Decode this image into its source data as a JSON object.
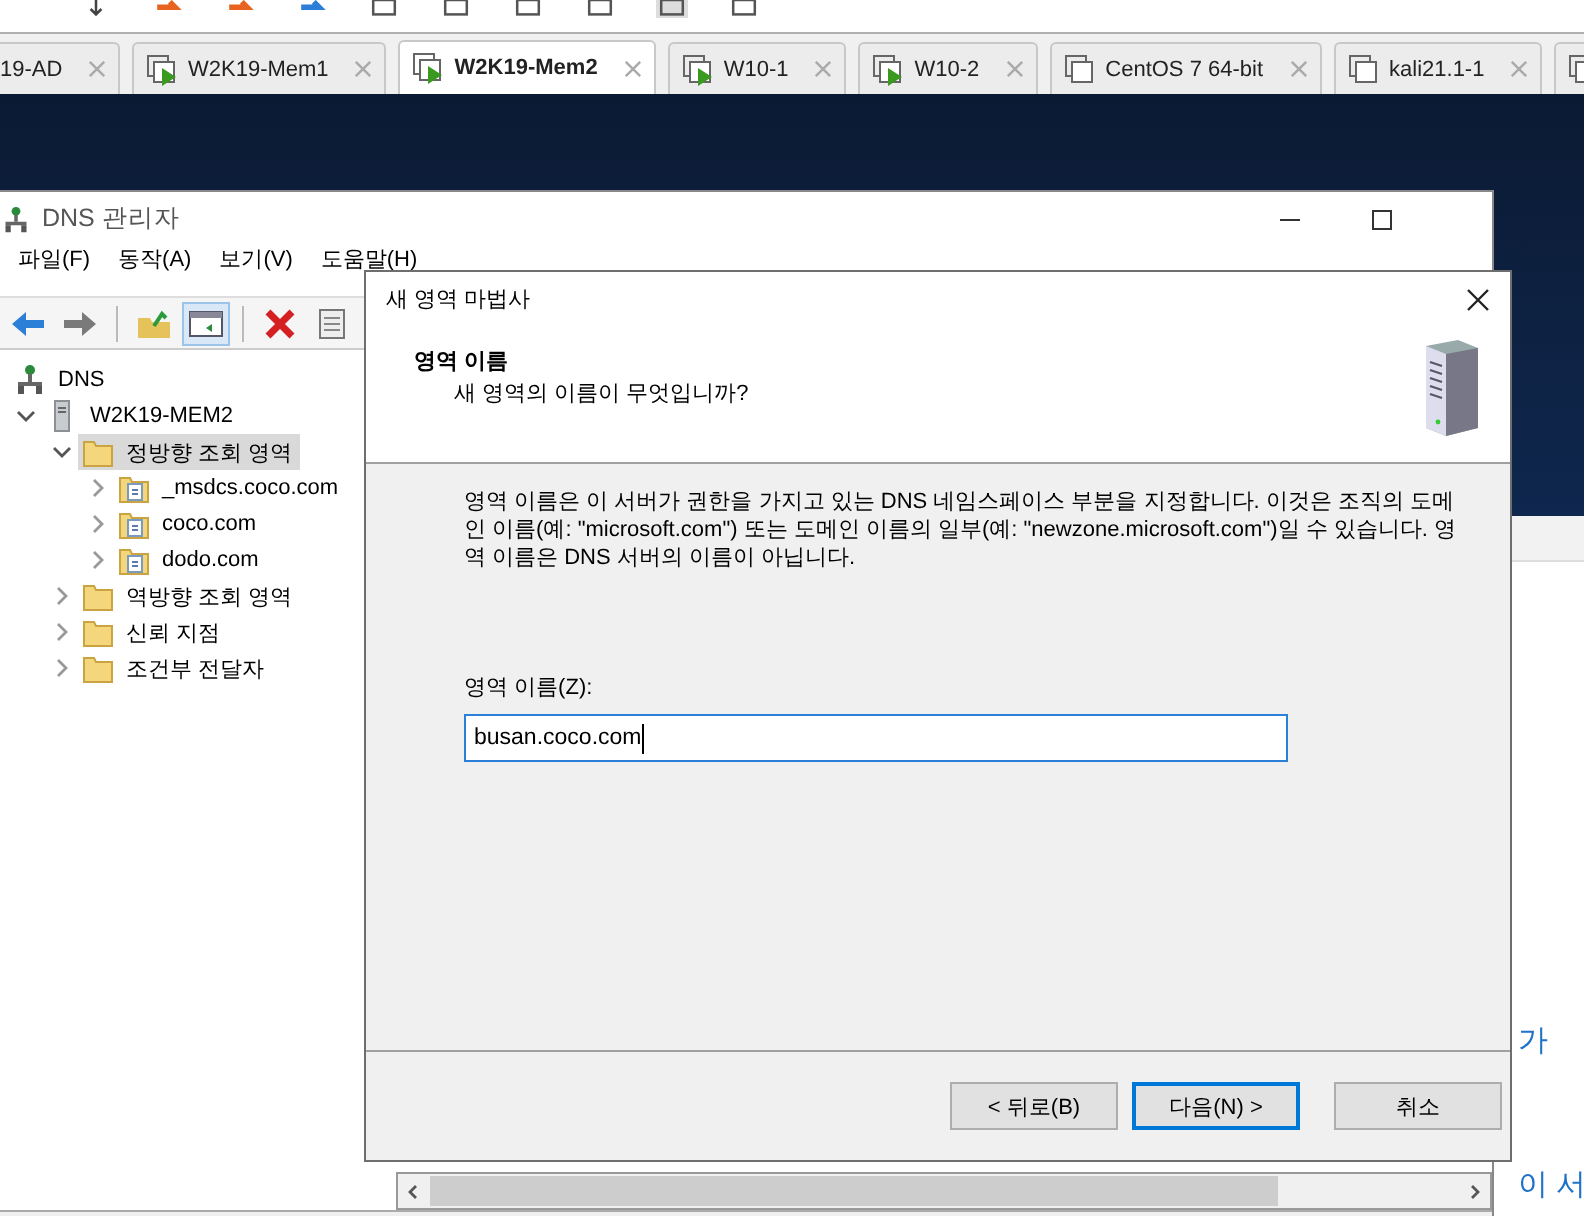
{
  "host_tabs": [
    {
      "label": "19-AD",
      "selected": false
    },
    {
      "label": "W2K19-Mem1",
      "selected": false,
      "running": true
    },
    {
      "label": "W2K19-Mem2",
      "selected": true,
      "running": true
    },
    {
      "label": "W10-1",
      "selected": false,
      "running": true
    },
    {
      "label": "W10-2",
      "selected": false,
      "running": true
    },
    {
      "label": "CentOS 7 64-bit",
      "selected": false,
      "running": false
    },
    {
      "label": "kali21.1-1",
      "selected": false,
      "running": false
    }
  ],
  "background_window": {
    "texts": [
      "가",
      "이 서"
    ]
  },
  "dns_window": {
    "title": "DNS 관리자",
    "menu": [
      "파일(F)",
      "동작(A)",
      "보기(V)",
      "도움말(H)"
    ],
    "tree": [
      {
        "label": "DNS",
        "kind": "root",
        "selected": false,
        "children": [
          {
            "label": "W2K19-MEM2",
            "kind": "server",
            "selected": false,
            "expanded": true,
            "children": [
              {
                "label": "정방향 조회 영역",
                "kind": "folder",
                "selected": true,
                "expanded": true,
                "children": [
                  {
                    "label": "_msdcs.coco.com",
                    "kind": "zone",
                    "selected": false,
                    "expanded": false
                  },
                  {
                    "label": "coco.com",
                    "kind": "zone",
                    "selected": false,
                    "expanded": false
                  },
                  {
                    "label": "dodo.com",
                    "kind": "zone",
                    "selected": false,
                    "expanded": false
                  }
                ]
              },
              {
                "label": "역방향 조회 영역",
                "kind": "folder",
                "selected": false,
                "expanded": false
              },
              {
                "label": "신뢰 지점",
                "kind": "folder",
                "selected": false,
                "expanded": false
              },
              {
                "label": "조건부 전달자",
                "kind": "folder",
                "selected": false,
                "expanded": false
              }
            ]
          }
        ]
      }
    ]
  },
  "wizard": {
    "title": "새 영역 마법사",
    "heading": "영역 이름",
    "subheading": "새 영역의 이름이 무엇입니까?",
    "description": "영역 이름은 이 서버가 권한을 가지고 있는 DNS 네임스페이스 부분을 지정합니다. 이것은 조직의 도메인 이름(예: \"microsoft.com\") 또는 도메인 이름의 일부(예: \"newzone.microsoft.com\")일 수 있습니다. 영역 이름은 DNS 서버의 이름이 아닙니다.",
    "field_label": "영역 이름(Z):",
    "field_value": "busan.coco.com",
    "buttons": [
      {
        "label": "< 뒤로(B)",
        "default": false
      },
      {
        "label": "다음(N) >",
        "default": true
      },
      {
        "label": "취소",
        "default": false
      }
    ]
  }
}
